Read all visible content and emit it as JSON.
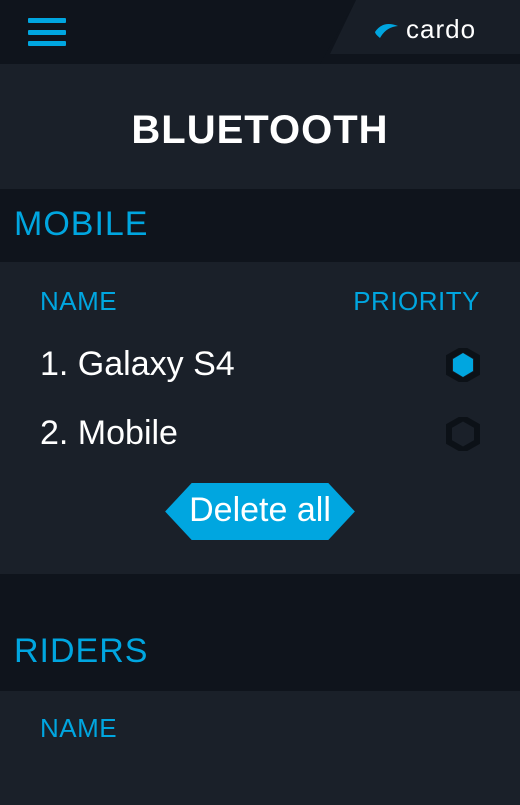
{
  "app": {
    "brand": "cardo",
    "title": "BLUETOOTH"
  },
  "colors": {
    "accent": "#00a6e0",
    "bg_dark": "#0f141c",
    "bg": "#1a2029",
    "active_hex": "#00a6e0",
    "inactive_hex": "#3f454e"
  },
  "sections": {
    "mobile": {
      "label": "MOBILE",
      "columns": {
        "name": "NAME",
        "priority": "PRIORITY"
      },
      "devices": [
        {
          "label": "1. Galaxy S4",
          "priority": true
        },
        {
          "label": "2. Mobile",
          "priority": false
        }
      ],
      "delete_all_label": "Delete all"
    },
    "riders": {
      "label": "RIDERS",
      "columns": {
        "name": "NAME"
      }
    }
  }
}
